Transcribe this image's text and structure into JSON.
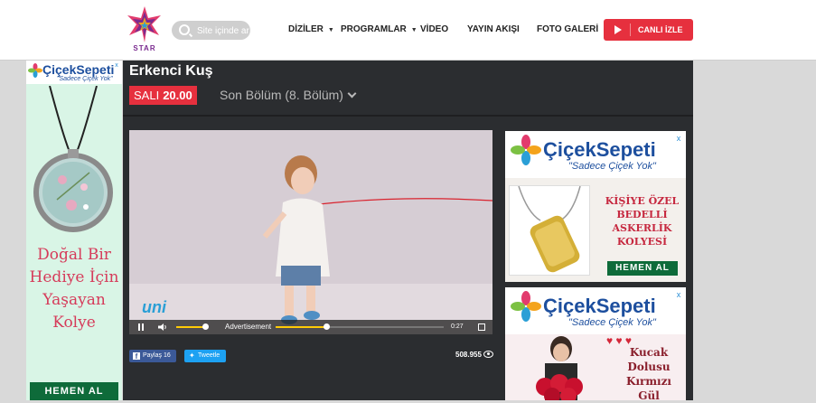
{
  "header": {
    "logo_text": "STAR",
    "search_placeholder": "Site içinde ar",
    "nav": [
      {
        "label": "DİZİLER",
        "caret": true
      },
      {
        "label": "PROGRAMLAR",
        "caret": true
      },
      {
        "label": "VİDEO",
        "caret": false
      },
      {
        "label": "YAYIN AKIŞI",
        "caret": false
      },
      {
        "label": "FOTO GALERİ",
        "caret": false
      }
    ],
    "live_label": "CANLI İZLE"
  },
  "left_ad": {
    "brand": "ÇiçekSepeti",
    "slogan": "\"Sadece Çiçek Yok\"",
    "close": "x",
    "lines": [
      "Doğal Bir",
      "Hediye İçin",
      "Yaşayan",
      "Kolye"
    ],
    "button": "HEMEN AL"
  },
  "show": {
    "title": "Erkenci Kuş",
    "day": "SALI",
    "time": "20.00",
    "episode": "Son Bölüm (8. Bölüm)"
  },
  "player": {
    "overlay_logo": "uni",
    "ad_label": "Advertisement",
    "remaining": "0:27",
    "volume": 0.8,
    "progress": 0.3
  },
  "share": {
    "facebook_label": "Paylaş 16",
    "twitter_label": "Tweetle",
    "views": "508.955"
  },
  "right_ads": [
    {
      "brand": "ÇiçekSepeti",
      "slogan": "\"Sadece Çiçek Yok\"",
      "close": "x",
      "lines": [
        "KİŞİYE ÖZEL",
        "BEDELLİ",
        "ASKERLİK",
        "KOLYESİ"
      ],
      "button": "HEMEN AL"
    },
    {
      "brand": "ÇiçekSepeti",
      "slogan": "\"Sadece Çiçek Yok\"",
      "close": "x",
      "lines": [
        "Kucak",
        "Dolusu",
        "Kırmızı",
        "Gül"
      ]
    }
  ],
  "colors": {
    "accent_red": "#e6303e",
    "brand_blue": "#1d4f9e",
    "ad_green": "#0e6b3a",
    "dark_panel": "#2b2d30"
  }
}
